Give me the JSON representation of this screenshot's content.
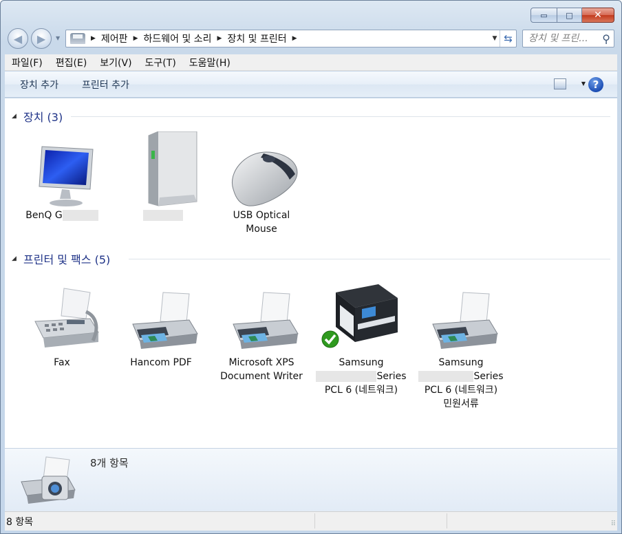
{
  "window": {
    "caption_buttons": {
      "minimize": "▭",
      "maximize": "□",
      "close": "✕"
    }
  },
  "nav": {
    "back_icon": "arrow-left-icon",
    "forward_icon": "arrow-right-icon",
    "breadcrumbs": [
      "제어판",
      "하드웨어 및 소리",
      "장치 및 프린터"
    ],
    "search_placeholder": "장치 및 프린..."
  },
  "menu": {
    "items": [
      "파일(F)",
      "편집(E)",
      "보기(V)",
      "도구(T)",
      "도움말(H)"
    ]
  },
  "commands": {
    "add_device": "장치 추가",
    "add_printer": "프린터 추가"
  },
  "groups": {
    "devices": {
      "title": "장치 (3)",
      "items": [
        {
          "label_1": "BenQ G",
          "label_2": "",
          "icon": "monitor-icon"
        },
        {
          "label_1": "",
          "label_2": "",
          "icon": "computer-tower-icon"
        },
        {
          "label_1": "USB Optical",
          "label_2": "Mouse",
          "icon": "mouse-icon"
        }
      ]
    },
    "printers": {
      "title": "프린터 및 팩스 (5)",
      "items": [
        {
          "label_1": "Fax",
          "icon": "fax-icon"
        },
        {
          "label_1": "Hancom PDF",
          "icon": "printer-icon"
        },
        {
          "label_1": "Microsoft XPS",
          "label_2": "Document Writer",
          "icon": "printer-icon"
        },
        {
          "label_1": "Samsung",
          "label_2": "Series",
          "label_3": "PCL 6 (네트워크)",
          "icon": "samsung-printer-icon",
          "default": true
        },
        {
          "label_1": "Samsung",
          "label_2": "Series",
          "label_3": "PCL 6 (네트워크)",
          "label_4": "민원서류",
          "icon": "printer-icon"
        }
      ]
    }
  },
  "details": {
    "count": "8개 항목"
  },
  "status": {
    "text": "8 항목"
  },
  "colors": {
    "group_title": "#1e3287",
    "default_check": "#2f9a1f"
  }
}
